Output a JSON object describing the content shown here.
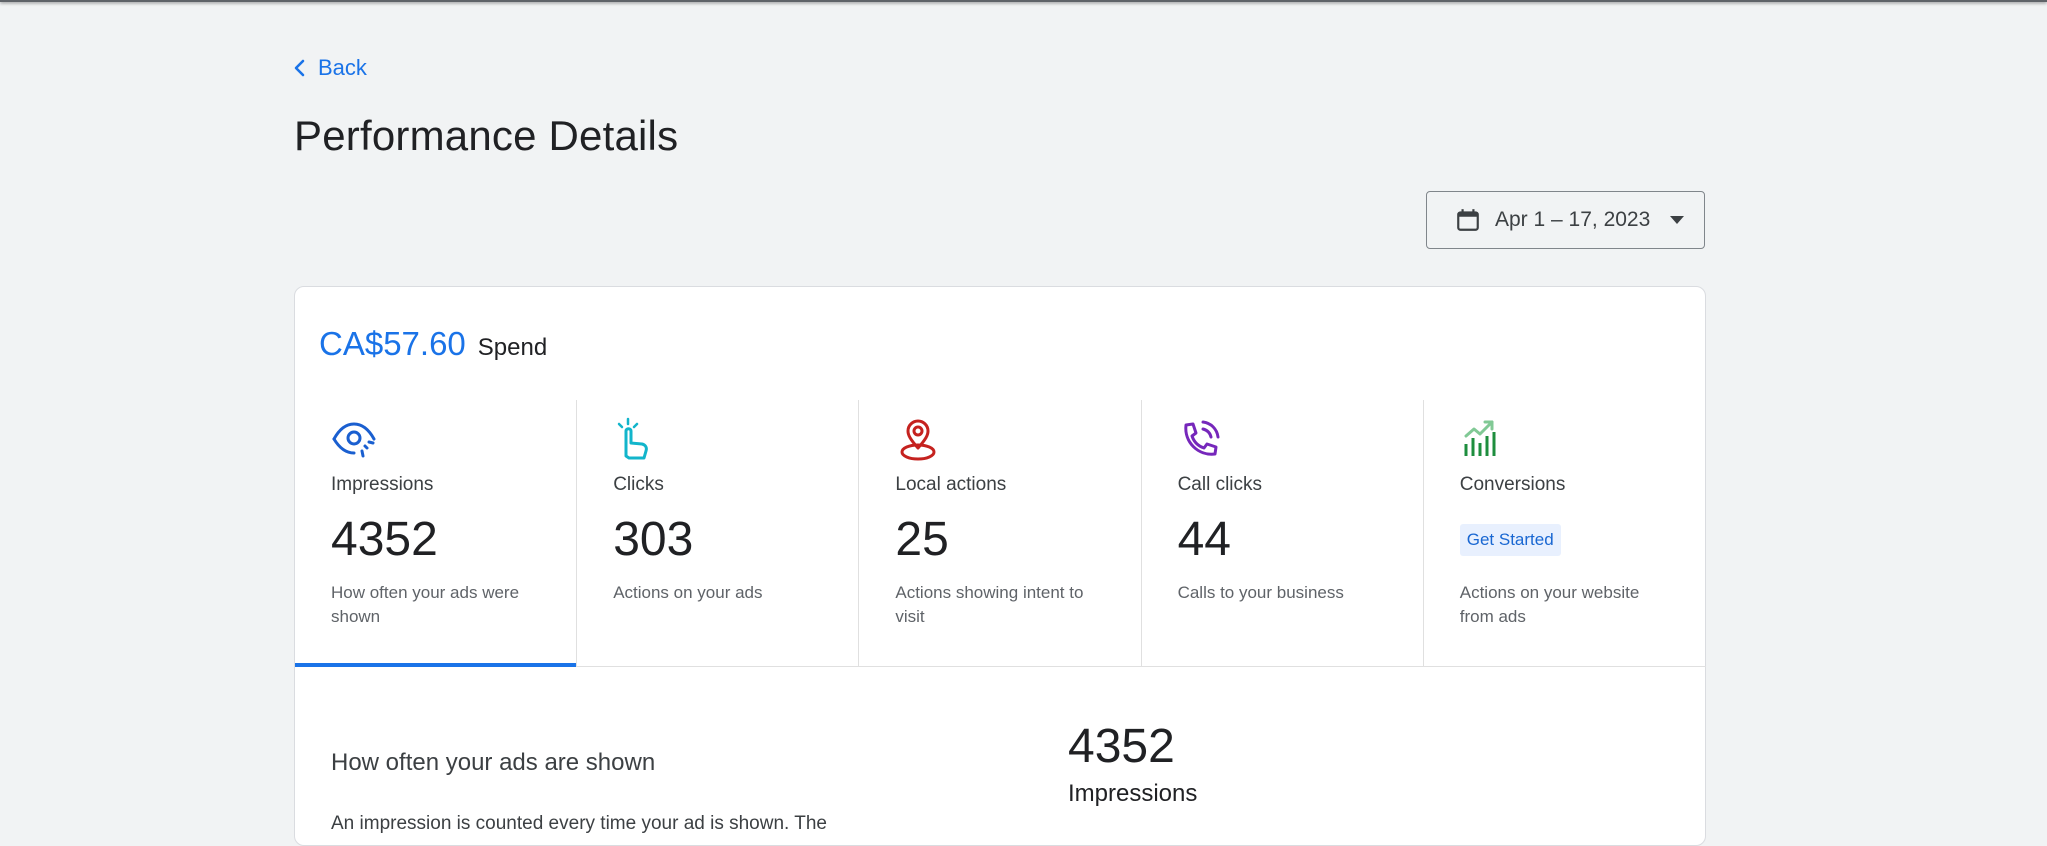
{
  "nav": {
    "back_label": "Back"
  },
  "page": {
    "title": "Performance Details"
  },
  "date_range": {
    "label": "Apr 1 – 17, 2023"
  },
  "spend": {
    "amount": "CA$57.60",
    "label": "Spend"
  },
  "metrics": [
    {
      "name": "Impressions",
      "value": "4352",
      "description": "How often your ads were shown",
      "icon": "eye-icon",
      "color": "#1a5fd0",
      "active": true
    },
    {
      "name": "Clicks",
      "value": "303",
      "description": "Actions on your ads",
      "icon": "tap-icon",
      "color": "#12b5cb"
    },
    {
      "name": "Local actions",
      "value": "25",
      "description": "Actions showing intent to visit",
      "icon": "location-pin-icon",
      "color": "#c5221f"
    },
    {
      "name": "Call clicks",
      "value": "44",
      "description": "Calls to your business",
      "icon": "phone-call-icon",
      "color": "#7627bb"
    },
    {
      "name": "Conversions",
      "badge": "Get Started",
      "description": "Actions on your website from ads",
      "icon": "trending-chart-icon",
      "color": "#1e8e3e"
    }
  ],
  "detail": {
    "title": "How often your ads are shown",
    "text": "An impression is counted every time your ad is shown. The",
    "value": "4352",
    "value_label": "Impressions"
  },
  "colors": {
    "accent": "#1a73e8",
    "background": "#f1f3f4"
  }
}
